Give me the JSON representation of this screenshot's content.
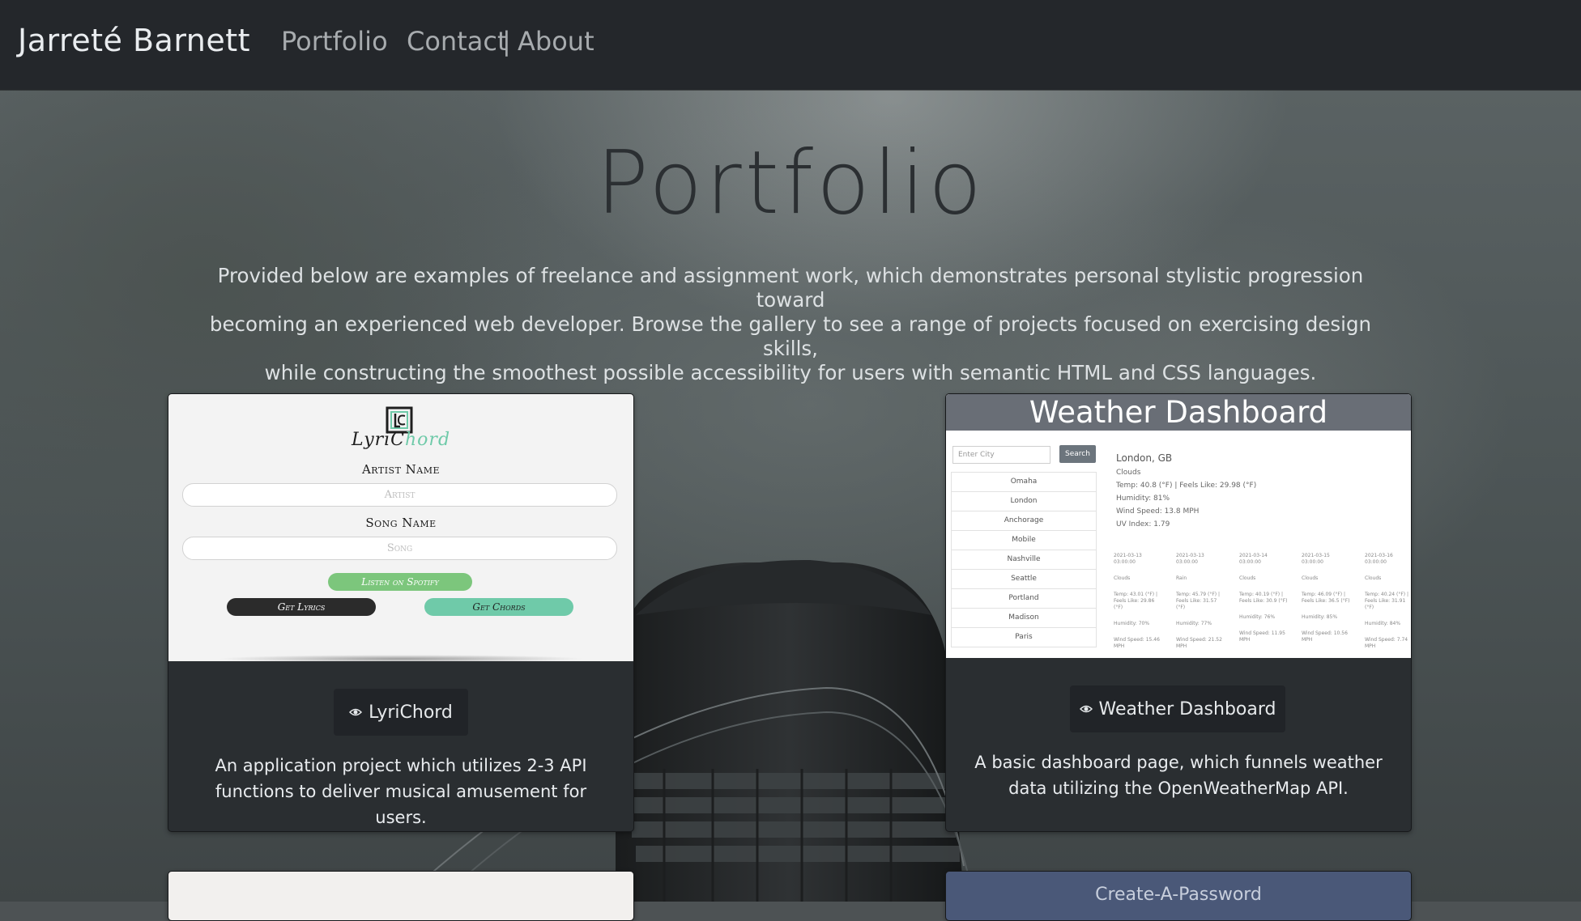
{
  "nav": {
    "brand": "Jarreté Barnett",
    "links": [
      "Portfolio",
      "Contact",
      "About"
    ],
    "separator": "|"
  },
  "header": {
    "title": "Portfolio",
    "intro_lines": [
      "Provided below are examples of freelance and assignment work, which demonstrates personal stylistic progression toward",
      "becoming an experienced web developer. Browse the gallery to see a range of projects focused on exercising design skills,",
      "while constructing the smoothest possible accessibility for users with semantic HTML and CSS languages."
    ]
  },
  "cards": [
    {
      "button_label": "LyriChord",
      "description_lines": [
        "An application project which utilizes 2-3 API",
        "functions to deliver musical amusement for users."
      ],
      "icon": "eye-icon",
      "screenshot": {
        "logo_letters": "LC",
        "wordmark_dark": "LyriC",
        "wordmark_accent": "hord",
        "artist_label": "Artist Name",
        "artist_placeholder": "Artist",
        "song_label": "Song Name",
        "song_placeholder": "Song",
        "spotify_button": "Listen on Spotify",
        "lyrics_button": "Get Lyrics",
        "chords_button": "Get Chords",
        "colors": {
          "accent": "#6fcaa9",
          "spotify": "#7cc67c",
          "dark": "#2b2b2b"
        }
      }
    },
    {
      "button_label": "Weather Dashboard",
      "description_lines": [
        "A basic dashboard page, which funnels weather",
        "data utilizing the OpenWeatherMap API."
      ],
      "icon": "eye-icon",
      "screenshot": {
        "header": "Weather Dashboard",
        "search_placeholder": "Enter City",
        "search_button": "Search",
        "cities": [
          "Omaha",
          "London",
          "Anchorage",
          "Mobile",
          "Nashville",
          "Seattle",
          "Portland",
          "Madison",
          "Paris"
        ],
        "current": {
          "city": "London, GB",
          "conditions": "Clouds",
          "temp": "Temp: 40.8 (°F) | Feels Like: 29.98 (°F)",
          "humidity": "Humidity: 81%",
          "wind": "Wind Speed: 13.8 MPH",
          "uv": "UV Index: 1.79"
        },
        "forecast": [
          {
            "date": "2021-03-13 03:00:00",
            "cond": "Clouds",
            "temp": "Temp: 43.01 (°F) | Feels Like: 29.86 (°F)",
            "hum": "Humidity: 70%",
            "wind": "Wind Speed: 15.46 MPH"
          },
          {
            "date": "2021-03-13 03:00:00",
            "cond": "Rain",
            "temp": "Temp: 45.79 (°F) | Feels Like: 31.57 (°F)",
            "hum": "Humidity: 77%",
            "wind": "Wind Speed: 21.52 MPH"
          },
          {
            "date": "2021-03-14 03:00:00",
            "cond": "Clouds",
            "temp": "Temp: 40.19 (°F) | Feels Like: 30.9 (°F)",
            "hum": "Humidity: 76%",
            "wind": "Wind Speed: 11.95 MPH"
          },
          {
            "date": "2021-03-15 03:00:00",
            "cond": "Clouds",
            "temp": "Temp: 46.09 (°F) | Feels Like: 36.5 (°F)",
            "hum": "Humidity: 85%",
            "wind": "Wind Speed: 10.56 MPH"
          },
          {
            "date": "2021-03-16 03:00:00",
            "cond": "Clouds",
            "temp": "Temp: 40.24 (°F) | Feels Like: 31.91 (°F)",
            "hum": "Humidity: 84%",
            "wind": "Wind Speed: 7.74 MPH"
          }
        ]
      }
    },
    {
      "button_label": ""
    },
    {
      "title": "Create-A-Password"
    }
  ],
  "colors": {
    "navbar": "#24272b",
    "card": "#2a2e31",
    "button": "#212428",
    "title": "#2b2f32"
  }
}
